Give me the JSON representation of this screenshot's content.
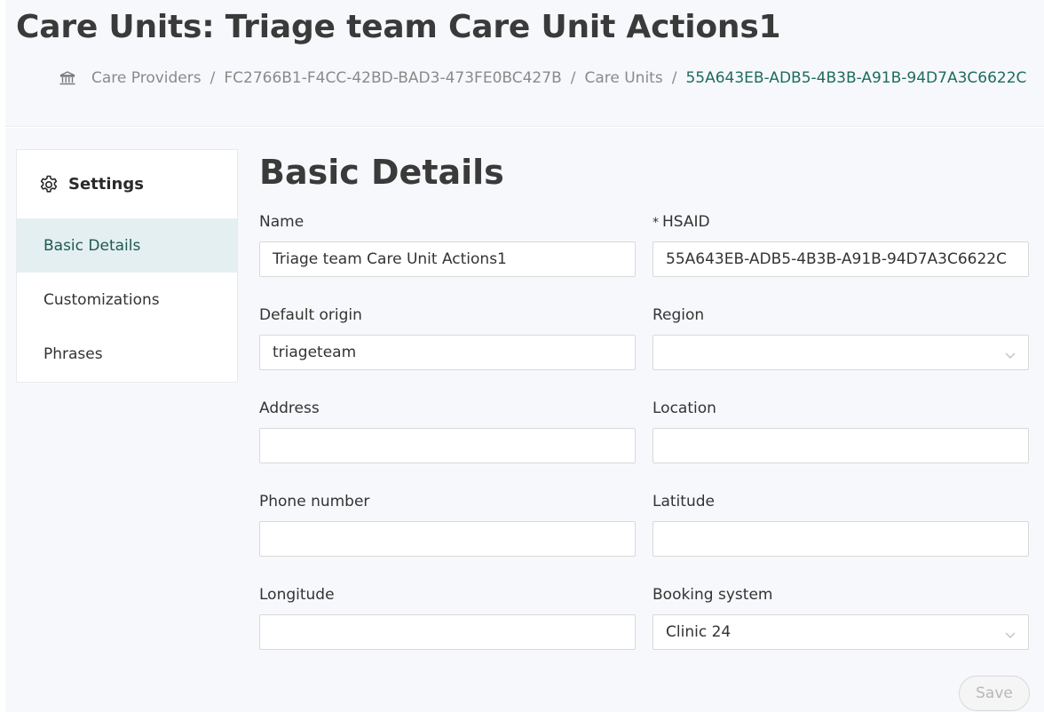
{
  "header": {
    "title": "Care Units: Triage team Care Unit Actions1",
    "breadcrumb": [
      {
        "label": "Care Providers"
      },
      {
        "label": "FC2766B1-F4CC-42BD-BAD3-473FE0BC427B"
      },
      {
        "label": "Care Units"
      },
      {
        "label": "55A643EB-ADB5-4B3B-A91B-94D7A3C6622C"
      }
    ],
    "separator": "/"
  },
  "sidebar": {
    "title": "Settings",
    "items": [
      {
        "label": "Basic Details",
        "active": true
      },
      {
        "label": "Customizations",
        "active": false
      },
      {
        "label": "Phrases",
        "active": false
      }
    ]
  },
  "form": {
    "section_title": "Basic Details",
    "fields": {
      "name": {
        "label": "Name",
        "value": "Triage team Care Unit Actions1"
      },
      "hsaid": {
        "label": "HSAID",
        "required_mark": "*",
        "value": "55A643EB-ADB5-4B3B-A91B-94D7A3C6622C"
      },
      "default_origin": {
        "label": "Default origin",
        "value": "triageteam"
      },
      "region": {
        "label": "Region",
        "value": ""
      },
      "address": {
        "label": "Address",
        "value": ""
      },
      "location": {
        "label": "Location",
        "value": ""
      },
      "phone": {
        "label": "Phone number",
        "value": ""
      },
      "latitude": {
        "label": "Latitude",
        "value": ""
      },
      "longitude": {
        "label": "Longitude",
        "value": ""
      },
      "booking_system": {
        "label": "Booking system",
        "value": "Clinic 24"
      }
    },
    "save_label": "Save"
  },
  "colors": {
    "accent": "#1e6b5e",
    "active_menu_bg": "#e4eff2",
    "page_bg": "#f7f8fb"
  },
  "icons": {
    "home": "bank-icon",
    "settings": "gear-icon",
    "dropdown": "chevron-down-icon"
  }
}
